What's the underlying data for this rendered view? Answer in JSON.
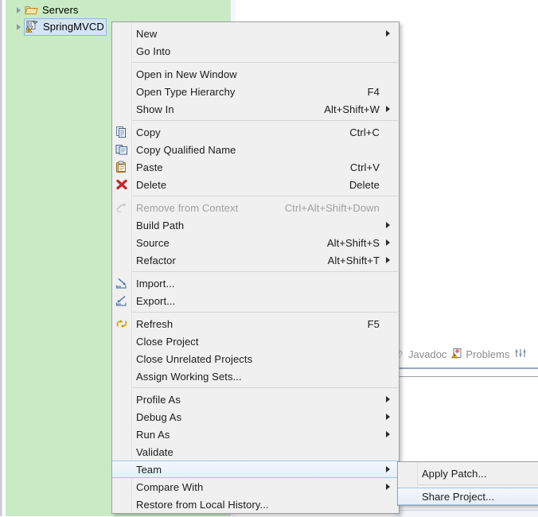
{
  "tree": {
    "items": [
      {
        "label": "Servers",
        "icon": "folder-icon",
        "expander": "collapsed-arrow",
        "selected": false
      },
      {
        "label": "SpringMVCD",
        "icon": "maven-project-warning-icon",
        "expander": "collapsed-arrow",
        "selected": true
      }
    ]
  },
  "views": {
    "tabs": [
      {
        "label": "Javadoc",
        "icon": "javadoc-icon"
      },
      {
        "label": "Problems",
        "icon": "problems-icon"
      }
    ],
    "toolbar_icon": "view-menu-icon"
  },
  "context_menu": {
    "name": "project-context-menu",
    "groups": [
      {
        "items": [
          {
            "label": "New",
            "accel": "",
            "icon": "",
            "submenu": true,
            "disabled": false,
            "highlight": false
          },
          {
            "label": "Go Into",
            "accel": "",
            "icon": "",
            "submenu": false,
            "disabled": false,
            "highlight": false
          }
        ]
      },
      {
        "items": [
          {
            "label": "Open in New Window",
            "accel": "",
            "icon": "",
            "submenu": false,
            "disabled": false,
            "highlight": false
          },
          {
            "label": "Open Type Hierarchy",
            "accel": "F4",
            "icon": "",
            "submenu": false,
            "disabled": false,
            "highlight": false
          },
          {
            "label": "Show In",
            "accel": "Alt+Shift+W",
            "icon": "",
            "submenu": true,
            "disabled": false,
            "highlight": false
          }
        ]
      },
      {
        "items": [
          {
            "label": "Copy",
            "accel": "Ctrl+C",
            "icon": "copy-icon",
            "submenu": false,
            "disabled": false,
            "highlight": false
          },
          {
            "label": "Copy Qualified Name",
            "accel": "",
            "icon": "copy-qualified-name-icon",
            "submenu": false,
            "disabled": false,
            "highlight": false
          },
          {
            "label": "Paste",
            "accel": "Ctrl+V",
            "icon": "paste-icon",
            "submenu": false,
            "disabled": false,
            "highlight": false
          },
          {
            "label": "Delete",
            "accel": "Delete",
            "icon": "delete-icon",
            "submenu": false,
            "disabled": false,
            "highlight": false
          }
        ]
      },
      {
        "items": [
          {
            "label": "Remove from Context",
            "accel": "Ctrl+Alt+Shift+Down",
            "icon": "remove-from-context-icon",
            "submenu": false,
            "disabled": true,
            "highlight": false
          },
          {
            "label": "Build Path",
            "accel": "",
            "icon": "",
            "submenu": true,
            "disabled": false,
            "highlight": false
          },
          {
            "label": "Source",
            "accel": "Alt+Shift+S",
            "icon": "",
            "submenu": true,
            "disabled": false,
            "highlight": false
          },
          {
            "label": "Refactor",
            "accel": "Alt+Shift+T",
            "icon": "",
            "submenu": true,
            "disabled": false,
            "highlight": false
          }
        ]
      },
      {
        "items": [
          {
            "label": "Import...",
            "accel": "",
            "icon": "import-icon",
            "submenu": false,
            "disabled": false,
            "highlight": false
          },
          {
            "label": "Export...",
            "accel": "",
            "icon": "export-icon",
            "submenu": false,
            "disabled": false,
            "highlight": false
          }
        ]
      },
      {
        "items": [
          {
            "label": "Refresh",
            "accel": "F5",
            "icon": "refresh-icon",
            "submenu": false,
            "disabled": false,
            "highlight": false
          },
          {
            "label": "Close Project",
            "accel": "",
            "icon": "",
            "submenu": false,
            "disabled": false,
            "highlight": false
          },
          {
            "label": "Close Unrelated Projects",
            "accel": "",
            "icon": "",
            "submenu": false,
            "disabled": false,
            "highlight": false
          },
          {
            "label": "Assign Working Sets...",
            "accel": "",
            "icon": "",
            "submenu": false,
            "disabled": false,
            "highlight": false
          }
        ]
      },
      {
        "items": [
          {
            "label": "Profile As",
            "accel": "",
            "icon": "",
            "submenu": true,
            "disabled": false,
            "highlight": false
          },
          {
            "label": "Debug As",
            "accel": "",
            "icon": "",
            "submenu": true,
            "disabled": false,
            "highlight": false
          },
          {
            "label": "Run As",
            "accel": "",
            "icon": "",
            "submenu": true,
            "disabled": false,
            "highlight": false
          },
          {
            "label": "Validate",
            "accel": "",
            "icon": "",
            "submenu": false,
            "disabled": false,
            "highlight": false
          },
          {
            "label": "Team",
            "accel": "",
            "icon": "",
            "submenu": true,
            "disabled": false,
            "highlight": true
          },
          {
            "label": "Compare With",
            "accel": "",
            "icon": "",
            "submenu": true,
            "disabled": false,
            "highlight": false
          },
          {
            "label": "Restore from Local History...",
            "accel": "",
            "icon": "",
            "submenu": false,
            "disabled": false,
            "highlight": false
          }
        ]
      }
    ]
  },
  "submenu": {
    "name": "team-submenu",
    "items": [
      {
        "label": "Apply Patch...",
        "accel": "",
        "icon": "",
        "submenu": false,
        "disabled": false,
        "highlight": false
      },
      {
        "label": "Share Project...",
        "accel": "",
        "icon": "",
        "submenu": false,
        "disabled": false,
        "highlight": true
      }
    ]
  },
  "colors": {
    "tree_background": "#c8ebc4",
    "menu_background": "#f0f0f0",
    "highlight_border": "#9ec7e8",
    "selection_fill": "#d4e4f7",
    "delete_red": "#c8252b",
    "refresh_gold": "#e0a81c"
  }
}
